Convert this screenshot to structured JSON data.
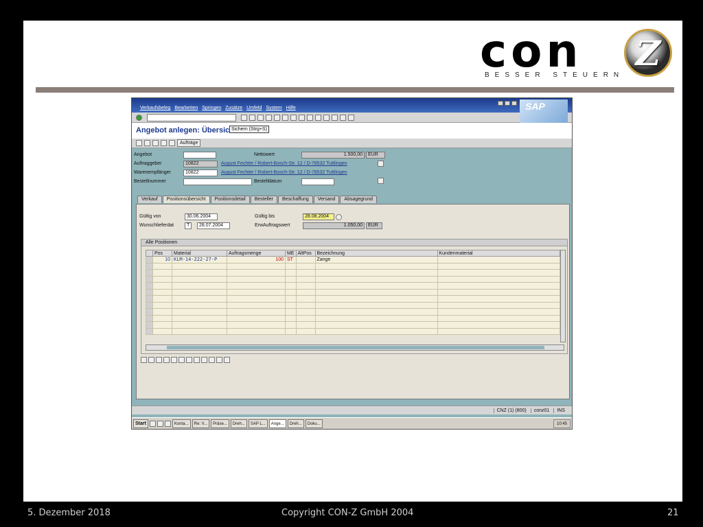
{
  "logo": {
    "main": "con",
    "badge": "Z",
    "tagline": "BESSER STEUERN"
  },
  "sap": {
    "menu": [
      "Verkaufsbeleg",
      "Bearbeiten",
      "Springen",
      "Zusätze",
      "Umfeld",
      "System",
      "Hilfe"
    ],
    "title": "Angebot anlegen: Übersic",
    "tooltip": "Sichern   (Strg+S)",
    "app_button": "Aufträge",
    "header": {
      "angebot_label": "Angebot",
      "auftraggeber_label": "Auftraggeber",
      "auftraggeber_value": "10822",
      "auftraggeber_addr": "August Fechter / Robert-Bosch-Str. 12 / D-78532 Tuttlingen",
      "warenempfaenger_label": "Warenempfänger",
      "warenempfaenger_value": "10822",
      "warenempfaenger_addr": "August Fechter / Robert-Bosch-Str. 12 / D-78532 Tuttlingen",
      "bestellnummer_label": "Bestellnummer",
      "nettowert_label": "Nettowert",
      "nettowert_value": "1.500,00",
      "nettowert_cur": "EUR",
      "bestelldatum_label": "Bestelldatum"
    },
    "tabs": [
      "Verkauf",
      "Positionsübersicht",
      "Positionsdetail",
      "Besteller",
      "Beschaffung",
      "Versand",
      "Absagegrund"
    ],
    "active_tab": 1,
    "details": {
      "gueltig_von_label": "Gültig von",
      "gueltig_von_value": "30.06.2004",
      "gueltig_bis_label": "Gültig bis",
      "gueltig_bis_value": "28.08.2004",
      "wunschliefer_label": "Wunschlieferdat",
      "wunschliefer_t": "T",
      "wunschliefer_value": "28.07.2004",
      "erw_label": "ErwAuftragswert",
      "erw_value": "1.050,00",
      "erw_cur": "EUR"
    },
    "group_title": "Alle Positionen",
    "columns": [
      "Pos",
      "Material",
      "Auftragsmenge",
      "ME",
      "AltPos",
      "Bezeichnung",
      "Kundenmaterial"
    ],
    "rows": [
      {
        "pos": "10",
        "material": "KLM-14-222-27-P",
        "menge": "100",
        "me": "ST",
        "alt": "",
        "bez": "Zange",
        "kmat": ""
      }
    ],
    "status": {
      "system": "CNZ (1) (800)",
      "user": "conz01",
      "mode": "INS"
    },
    "taskbar": [
      "Start",
      "Konta...",
      "Re: V...",
      "Präse...",
      "Dreh...",
      "SAP L...",
      "Ange...",
      "Dreh...",
      "Doku..."
    ],
    "clock": "10:45"
  },
  "footer": {
    "date": "5. Dezember 2018",
    "copyright": "Copyright CON-Z GmbH 2004",
    "page": "21"
  }
}
